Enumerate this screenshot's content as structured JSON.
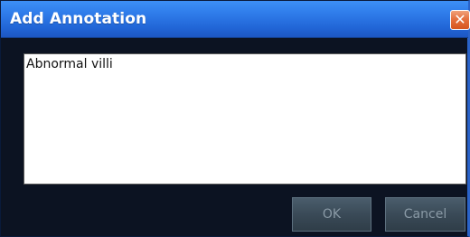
{
  "dialog": {
    "title": "Add Annotation",
    "close_icon": "close-icon",
    "close_glyph": "✕",
    "annotation_text": "Abnormal villi",
    "ok_label": "OK",
    "cancel_label": "Cancel"
  },
  "colors": {
    "titlebar": "#2f7cea",
    "close_button": "#e5713f",
    "dialog_background": "#0c1322",
    "button_background": "#3a4a57",
    "button_text": "#8a9aa6"
  }
}
